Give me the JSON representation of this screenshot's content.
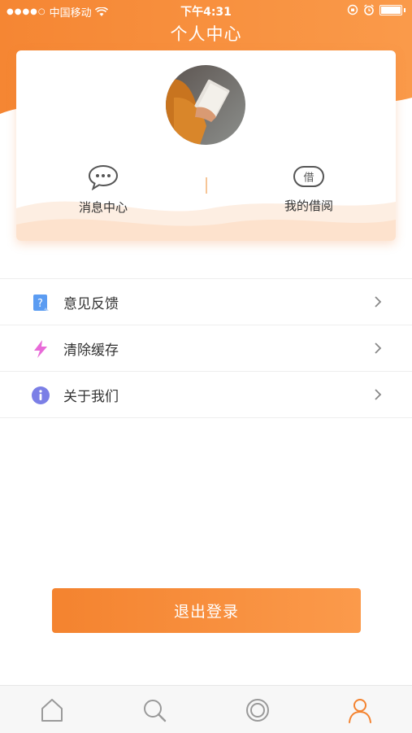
{
  "status_bar": {
    "carrier": "中国移动",
    "time": "下午4:31"
  },
  "header": {
    "title": "个人中心"
  },
  "profile_card": {
    "actions": [
      {
        "label": "消息中心",
        "icon": "chat-bubble-icon"
      },
      {
        "label": "我的借阅",
        "icon": "borrow-badge-icon",
        "icon_text": "借"
      }
    ]
  },
  "menu": {
    "items": [
      {
        "label": "意见反馈",
        "icon": "feedback-icon",
        "color": "#5b9cf2"
      },
      {
        "label": "清除缓存",
        "icon": "lightning-icon",
        "color": "#e86ad8"
      },
      {
        "label": "关于我们",
        "icon": "info-icon",
        "color": "#7b7fe6"
      }
    ]
  },
  "logout_button": {
    "label": "退出登录"
  },
  "tab_bar": {
    "tabs": [
      {
        "icon": "home-icon",
        "active": false
      },
      {
        "icon": "search-icon",
        "active": false
      },
      {
        "icon": "circle-icon",
        "active": false
      },
      {
        "icon": "user-icon",
        "active": true
      }
    ]
  },
  "colors": {
    "accent": "#f4832f",
    "accent_light": "#fb9a4b",
    "divider": "#eeeeee"
  }
}
